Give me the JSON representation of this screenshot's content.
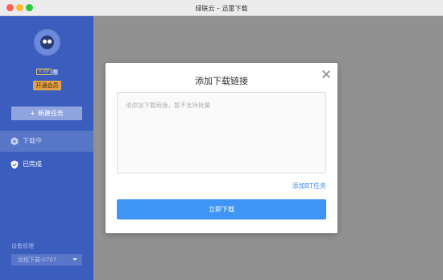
{
  "window": {
    "title": "绿联云 – 迅雷下载"
  },
  "sidebar": {
    "vip_tag": "V VIP",
    "vip_level": "0",
    "vip_button": "开通会员",
    "new_task_label": "新建任务",
    "items": [
      {
        "label": "下载中",
        "icon": "download-gear-icon",
        "active": true
      },
      {
        "label": "已完成",
        "icon": "check-shield-icon",
        "active": false
      }
    ],
    "device_label": "设备管理",
    "device_value": "远程下载-0707"
  },
  "modal": {
    "title": "添加下载链接",
    "input_placeholder": "请添加下载链接，暂不支持批量",
    "bt_link": "添加BT任务",
    "download_button": "立即下载"
  },
  "colors": {
    "sidebar": "#3b5ebe",
    "accent": "#3f95f5",
    "link": "#3d8ff0",
    "vip": "#e0a04a"
  }
}
